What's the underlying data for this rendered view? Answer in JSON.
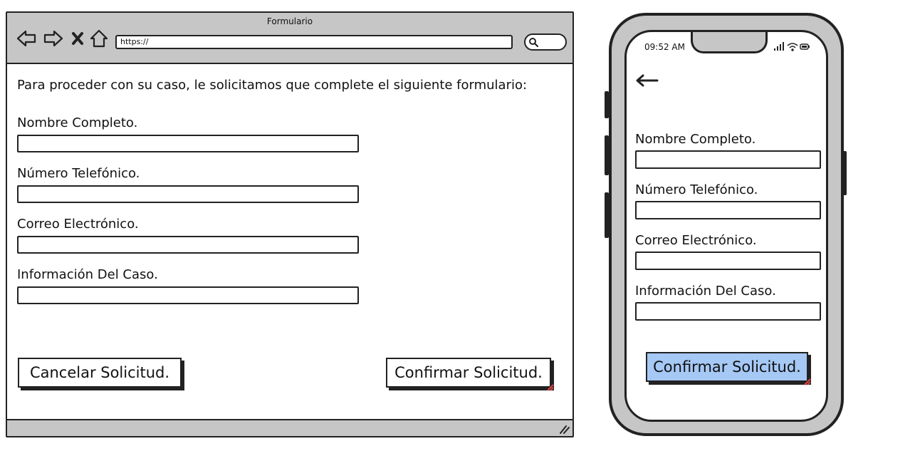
{
  "browser": {
    "title": "Formulario",
    "url": "https://",
    "nav_icons": [
      "back-arrow-icon",
      "forward-arrow-icon",
      "close-x-icon",
      "home-icon"
    ],
    "search_icon": "search-icon",
    "background_gray": "#c6c6c6"
  },
  "form": {
    "intro": "Para proceder con su caso, le solicitamos que complete el siguiente formulario:",
    "fields": [
      {
        "label": "Nombre Completo.",
        "value": ""
      },
      {
        "label": "Número Telefónico.",
        "value": ""
      },
      {
        "label": "Correo Electrónico.",
        "value": ""
      },
      {
        "label": "Información Del Caso.",
        "value": ""
      }
    ],
    "cancel_label": "Cancelar Solicitud.",
    "confirm_label": "Confirmar Solicitud."
  },
  "phone": {
    "time": "09:52 AM",
    "fields": [
      {
        "label": "Nombre Completo.",
        "value": ""
      },
      {
        "label": "Número Telefónico.",
        "value": ""
      },
      {
        "label": "Correo Electrónico.",
        "value": ""
      },
      {
        "label": "Información Del Caso.",
        "value": ""
      }
    ],
    "confirm_label": "Confirmar Solicitud.",
    "confirm_color": "#a5c8f5"
  }
}
